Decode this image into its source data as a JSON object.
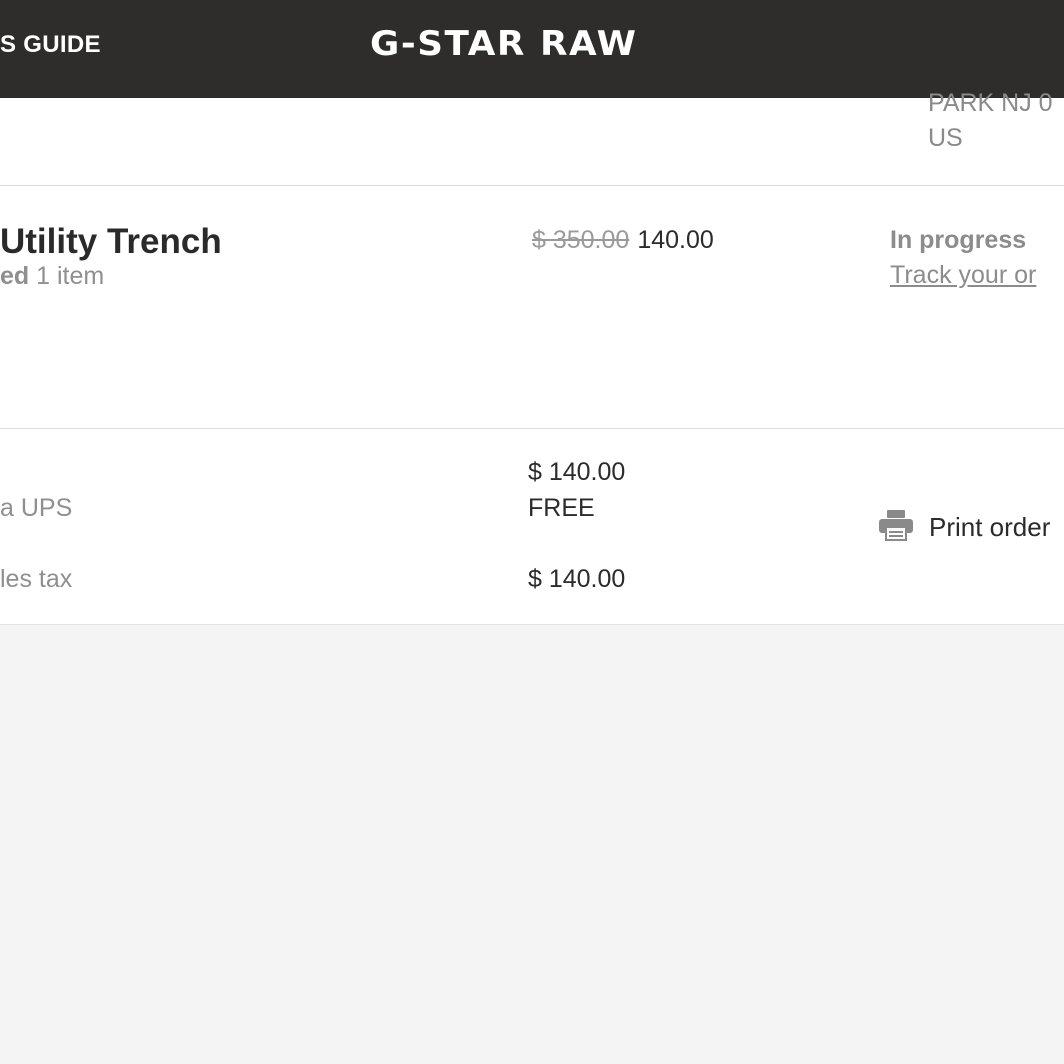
{
  "header": {
    "nav_link": "S GUIDE",
    "brand": "G-STAR RAW"
  },
  "shipping_address": {
    "line1": "PARK NJ 0",
    "line2": "US"
  },
  "order_item": {
    "name": "Utility Trench",
    "count_prefix": "ed",
    "count_text": " 1 item",
    "price_original": "$ 350.00",
    "price_sale": "140.00",
    "status": "In progress",
    "track_link": "Track your or"
  },
  "summary": {
    "subtotal_value": "$ 140.00",
    "shipping_label": "a UPS",
    "shipping_value": "FREE",
    "total_label": "les tax",
    "total_value": "$ 140.00"
  },
  "actions": {
    "print_label": "Print order",
    "print_icon": "printer-icon"
  },
  "colors": {
    "header_bg": "#2e2d2c",
    "page_bg": "#f4f4f4",
    "panel_bg": "#ffffff",
    "muted_text": "#8f8f8f"
  }
}
